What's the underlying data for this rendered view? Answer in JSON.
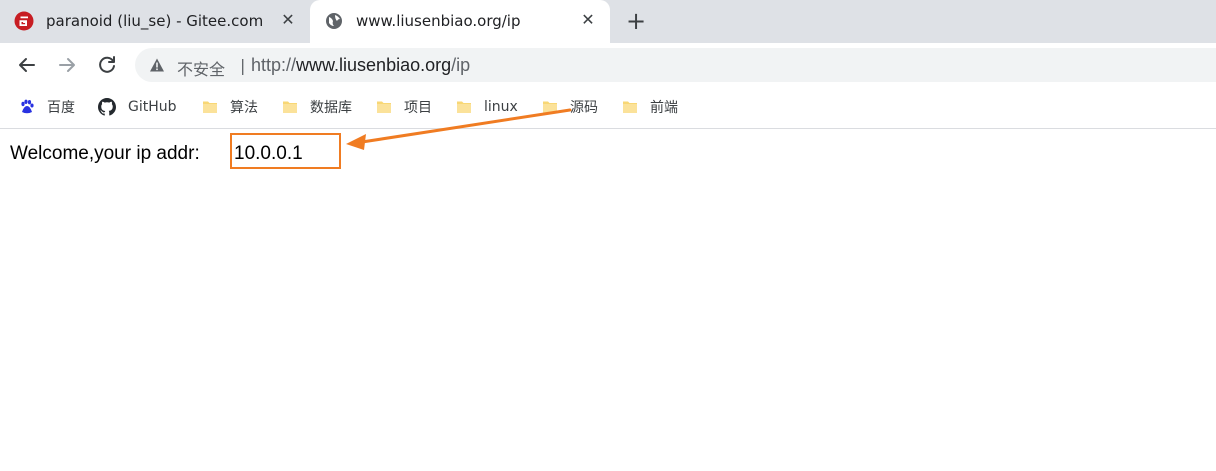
{
  "tabs": [
    {
      "title": "paranoid (liu_se) - Gitee.com",
      "icon": "gitee-logo-icon",
      "active": false
    },
    {
      "title": "www.liusenbiao.org/ip",
      "icon": "globe-icon",
      "active": true
    }
  ],
  "tab_close": "✕",
  "new_tab": "+",
  "omnibox": {
    "security": "不安全",
    "separator": "|",
    "url_scheme": "http://",
    "url_host": "www.liusenbiao.org",
    "url_path": "/ip"
  },
  "bookmarks": [
    {
      "label": "百度",
      "icon": "baidu-paw-icon"
    },
    {
      "label": "GitHub",
      "icon": "github-icon"
    },
    {
      "label": "算法",
      "icon": "folder-icon"
    },
    {
      "label": "数据库",
      "icon": "folder-icon"
    },
    {
      "label": "项目",
      "icon": "folder-icon"
    },
    {
      "label": "linux",
      "icon": "folder-icon"
    },
    {
      "label": "源码",
      "icon": "folder-icon"
    },
    {
      "label": "前端",
      "icon": "folder-icon"
    }
  ],
  "page": {
    "welcome": "Welcome,your ip addr:",
    "ip": "10.0.0.1"
  },
  "colors": {
    "annotation": "#f07c22",
    "tabbar": "#dee1e6",
    "folder": "#f8d775",
    "gitee_red": "#c71d23",
    "baidu_blue": "#2932e1"
  }
}
